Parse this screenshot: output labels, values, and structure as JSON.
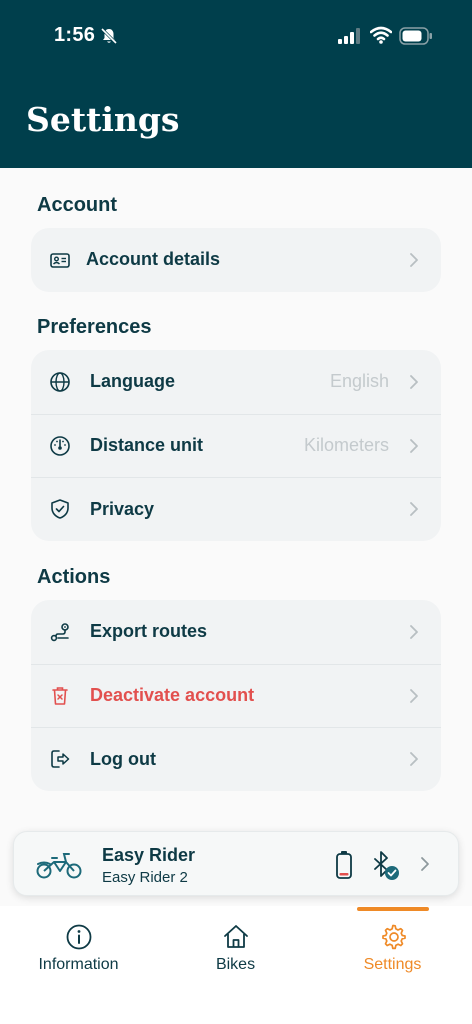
{
  "status_bar": {
    "time": "1:56"
  },
  "header": {
    "title": "Settings"
  },
  "sections": {
    "account": {
      "title": "Account",
      "items": [
        {
          "label": "Account details",
          "value": ""
        }
      ]
    },
    "preferences": {
      "title": "Preferences",
      "items": [
        {
          "label": "Language",
          "value": "English"
        },
        {
          "label": "Distance unit",
          "value": "Kilometers"
        },
        {
          "label": "Privacy",
          "value": ""
        }
      ]
    },
    "actions": {
      "title": "Actions",
      "items": [
        {
          "label": "Export routes",
          "value": ""
        },
        {
          "label": "Deactivate account",
          "value": ""
        },
        {
          "label": "Log out",
          "value": ""
        }
      ]
    }
  },
  "bike": {
    "name": "Easy Rider",
    "model": "Easy Rider 2"
  },
  "tabs": [
    {
      "label": "Information"
    },
    {
      "label": "Bikes"
    },
    {
      "label": "Settings"
    }
  ],
  "colors": {
    "header": "#003f4c",
    "text": "#0e3a45",
    "accent": "#ef8a27",
    "danger": "#e2504e",
    "card": "#f1f3f4"
  }
}
